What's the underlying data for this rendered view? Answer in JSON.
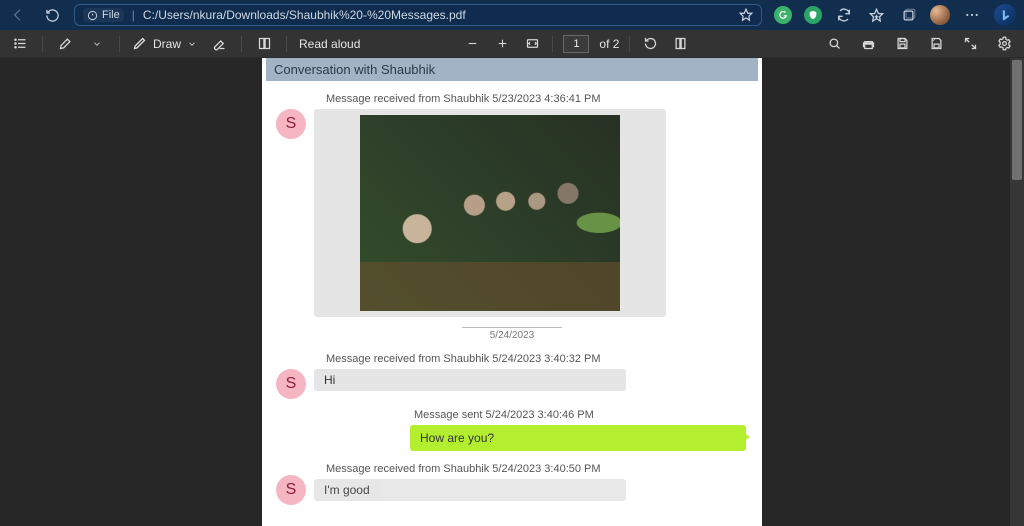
{
  "browser": {
    "file_pill": "File",
    "url": "C:/Users/nkura/Downloads/Shaubhik%20-%20Messages.pdf"
  },
  "pdfbar": {
    "draw_label": "Draw",
    "read_aloud_label": "Read aloud",
    "page_current": "1",
    "page_total_prefix": "of",
    "page_total": "2"
  },
  "doc": {
    "banner": "Conversation with Shaubhik",
    "messages": [
      {
        "meta": "Message received from Shaubhik 5/23/2023 4:36:41 PM",
        "avatar": "S",
        "kind": "received-image"
      },
      {
        "divider_date": "5/24/2023"
      },
      {
        "meta": "Message received from Shaubhik 5/24/2023 3:40:32 PM",
        "avatar": "S",
        "kind": "received-text",
        "text": "Hi"
      },
      {
        "meta": "Message sent 5/24/2023 3:40:46 PM",
        "kind": "sent-text",
        "text": "How are you?"
      },
      {
        "meta": "Message received from Shaubhik 5/24/2023 3:40:50 PM",
        "avatar": "S",
        "kind": "received-text",
        "text": "I'm good"
      }
    ]
  }
}
